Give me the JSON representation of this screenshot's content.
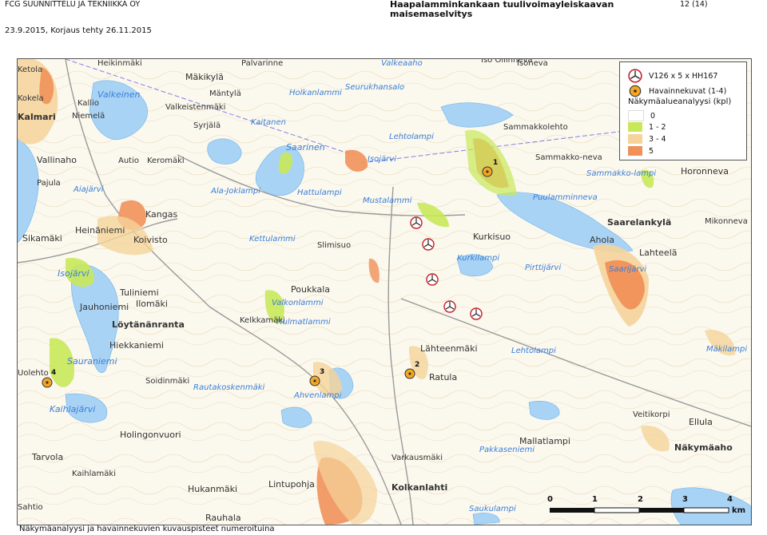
{
  "header": {
    "company": "FCG SUUNNITTELU JA TEKNIIKKA OY",
    "title_line1": "Haapalamminkankaan tuulivoimayleiskaavan",
    "title_line2": "maisemaselvitys",
    "page": "12 (14)",
    "date": "23.9.2015, Korjaus tehty 26.11.2015"
  },
  "footer": {
    "caption": "Näkymäanalyysi ja havainnekuvien kuvauspisteet numeroituina"
  },
  "legend": {
    "turbine_label": "V126 x 5 x HH167",
    "photo_label": "Havainnekuvat (1-4)",
    "analysis_title": "Näkymäalueanalyysi (kpl)",
    "classes": [
      {
        "label": "0",
        "color": "#ffffff"
      },
      {
        "label": "1 - 2",
        "color": "#c8e85a"
      },
      {
        "label": "3 - 4",
        "color": "#f5d39a"
      },
      {
        "label": "5",
        "color": "#f0915a"
      }
    ]
  },
  "scale": {
    "ticks": [
      "0",
      "1",
      "2",
      "3",
      "4"
    ],
    "unit": "km"
  },
  "photo_points": [
    "1",
    "2",
    "3",
    "4"
  ],
  "colors": {
    "water": "#a9d3f5",
    "water_label": "#3a7fd8",
    "visibility_low": "#c8e85a",
    "visibility_mid": "#f5d39a",
    "visibility_high": "#f0915a",
    "road": "#9a9a9a"
  },
  "places": [
    "Heikinmäki",
    "Palvarinne",
    "Valkeaaho",
    "Iso Ollinneva",
    "Isoneva",
    "Ketola",
    "Mäkikylä",
    "Mäntylä",
    "Valkeinen",
    "Valkeistenmäki",
    "Kallio",
    "Niemelä",
    "Kokela",
    "Kalmari",
    "Syrjälä",
    "Kaitanen",
    "Holkanlammi",
    "Seurukhansalo",
    "Lehtolampi",
    "Saarinen",
    "Sammakkolehto",
    "Sammakko-neva",
    "Sammakko-lampi",
    "Horonneva",
    "Vallinaho",
    "Autio",
    "Keromäki",
    "Isojärvi",
    "Pajula",
    "Aiajärvi",
    "Ala-Joklampi",
    "Hattulampi",
    "Mustalammi",
    "Puulamminneva",
    "Kangas",
    "Saarelankylä",
    "Mikonneva",
    "Heinäniemi",
    "Koivisto",
    "Ahola",
    "Lahteelä",
    "Sikamäki",
    "Kettulammi",
    "Kurkisuo",
    "Slimisuo",
    "Kurkilampi",
    "Pirttijärvi",
    "Isojärvi",
    "Tuliniemi",
    "Ilomäki",
    "Jauhoniemi",
    "Saarijärvi",
    "Poukkala",
    "Valkonlammi",
    "Löytänänranta",
    "Kelkkamäki",
    "Hulmatlammi",
    "Hiekkaniemi",
    "Lähteenmäki",
    "Lehtolampi",
    "Mäkilampi",
    "Sauraniemi",
    "Ratula",
    "Soidinmäki",
    "Kaihlajärvi",
    "Rautakoskenmäki",
    "Ahvenlampi",
    "Holingonvuori",
    "Veitikorpi",
    "Ellula",
    "Mallatlampi",
    "Pakkaseniemi",
    "Näkymäaho",
    "Tarvola",
    "Varkausmäki",
    "Kaihlamäki",
    "Hukanmäki",
    "Lintupohja",
    "Kolkanlahti",
    "Saukulampi",
    "Rauhala",
    "Sahtio",
    "Uolehto"
  ]
}
